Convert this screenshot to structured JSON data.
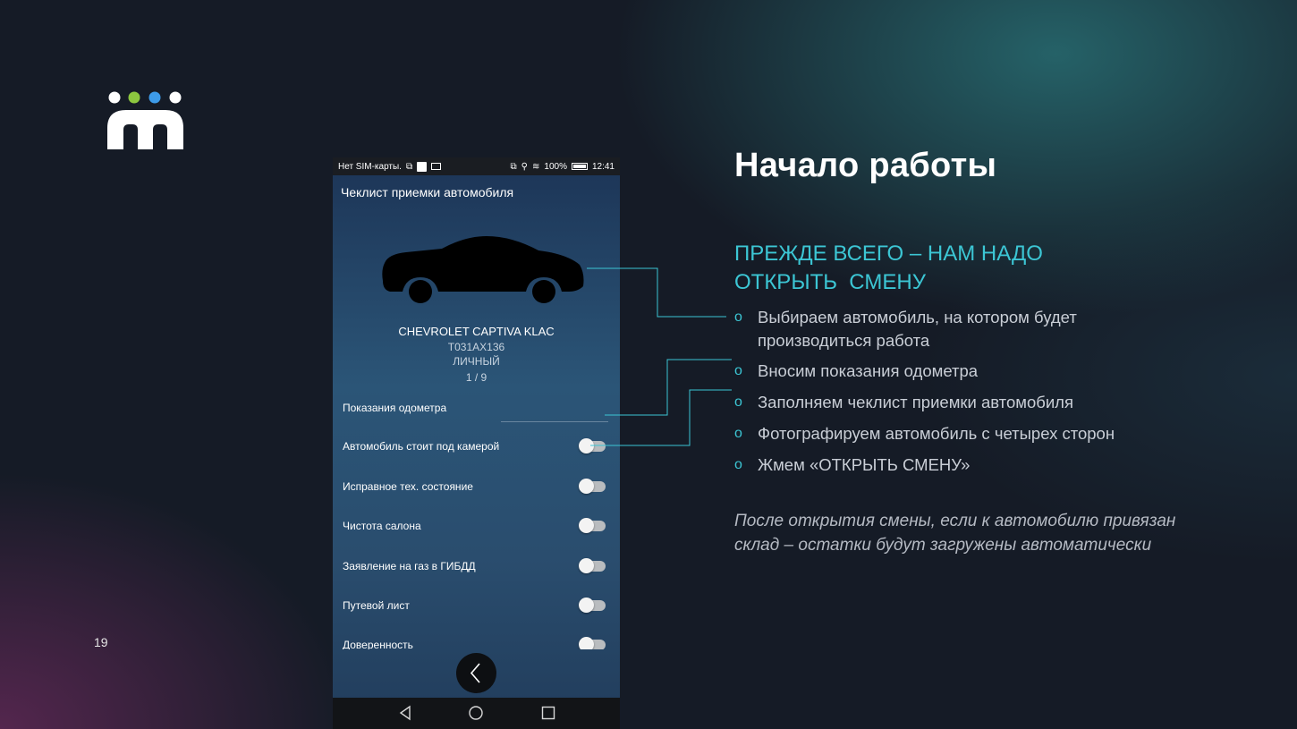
{
  "slide": {
    "page_number": "19",
    "heading": "Начало работы",
    "subheading_line1": "ПРЕЖДЕ ВСЕГО – НАМ НАДО",
    "subheading_line2": "ОТКРЫТЬ  СМЕНУ",
    "bullets": [
      {
        "text": "Выбираем автомобиль, на котором будет производиться работа"
      },
      {
        "text": "Вносим показания одометра"
      },
      {
        "text": "Заполняем чеклист приемки автомобиля"
      },
      {
        "text": "Фотографируем автомобиль с четырех сторон"
      },
      {
        "text": "Жмем «ОТКРЫТЬ СМЕНУ»"
      }
    ],
    "bullet_marker": "o",
    "note": "После открытия смены, если к автомобилю привязан склад – остатки будут загружены автоматически",
    "colors": {
      "accent": "#3cc6d4",
      "logo_green": "#8cc63f",
      "logo_blue": "#3d9be9"
    }
  },
  "phone": {
    "status_bar": {
      "carrier": "Нет SIM-карты.",
      "battery": "100%",
      "time": "12:41"
    },
    "app_title": "Чеклист приемки автомобиля",
    "car": {
      "model": "CHEVROLET CAPTIVA KLAC",
      "plate": "Т031АХ136",
      "type": "ЛИЧНЫЙ",
      "page": "1 / 9"
    },
    "odometer_label": "Показания одометра",
    "checklist": [
      {
        "label": "Автомобиль стоит под камерой",
        "on": false
      },
      {
        "label": "Исправное тех. состояние",
        "on": false
      },
      {
        "label": "Чистота салона",
        "on": false
      },
      {
        "label": "Заявление на газ в ГИБДД",
        "on": false
      },
      {
        "label": "Путевой лист",
        "on": false
      },
      {
        "label": "Доверенность",
        "on": false
      }
    ],
    "icons": [
      "back-arrow-icon",
      "nav-back-icon",
      "nav-home-icon",
      "nav-recents-icon"
    ]
  }
}
